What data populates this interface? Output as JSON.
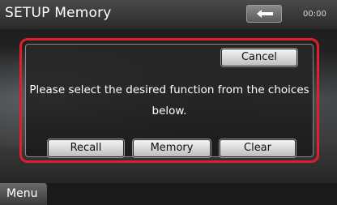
{
  "header": {
    "title": "SETUP Memory",
    "back_icon": "back-arrow-icon",
    "clock": "00:00"
  },
  "dialog": {
    "cancel_label": "Cancel",
    "message_line1": "Please select the desired function from the choices",
    "message_line2": "below.",
    "buttons": {
      "recall": "Recall",
      "memory": "Memory",
      "clear": "Clear"
    },
    "highlight_color": "#e01e2e"
  },
  "footer": {
    "menu_label": "Menu"
  }
}
